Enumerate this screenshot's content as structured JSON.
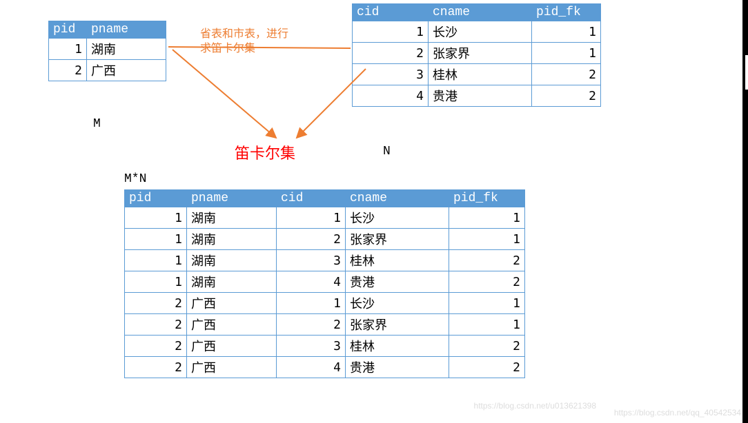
{
  "leftTable": {
    "headers": [
      "pid",
      "pname"
    ],
    "rows": [
      {
        "pid": 1,
        "pname": "湖南"
      },
      {
        "pid": 2,
        "pname": "广西"
      }
    ]
  },
  "rightTable": {
    "headers": [
      "cid",
      "cname",
      "pid_fk"
    ],
    "rows": [
      {
        "cid": 1,
        "cname": "长沙",
        "pid_fk": 1
      },
      {
        "cid": 2,
        "cname": "张家界",
        "pid_fk": 1
      },
      {
        "cid": 3,
        "cname": "桂林",
        "pid_fk": 2
      },
      {
        "cid": 4,
        "cname": "贵港",
        "pid_fk": 2
      }
    ]
  },
  "resultTable": {
    "headers": [
      "pid",
      "pname",
      "cid",
      "cname",
      "pid_fk"
    ],
    "rows": [
      {
        "pid": 1,
        "pname": "湖南",
        "cid": 1,
        "cname": "长沙",
        "pid_fk": 1
      },
      {
        "pid": 1,
        "pname": "湖南",
        "cid": 2,
        "cname": "张家界",
        "pid_fk": 1
      },
      {
        "pid": 1,
        "pname": "湖南",
        "cid": 3,
        "cname": "桂林",
        "pid_fk": 2
      },
      {
        "pid": 1,
        "pname": "湖南",
        "cid": 4,
        "cname": "贵港",
        "pid_fk": 2
      },
      {
        "pid": 2,
        "pname": "广西",
        "cid": 1,
        "cname": "长沙",
        "pid_fk": 1
      },
      {
        "pid": 2,
        "pname": "广西",
        "cid": 2,
        "cname": "张家界",
        "pid_fk": 1
      },
      {
        "pid": 2,
        "pname": "广西",
        "cid": 3,
        "cname": "桂林",
        "pid_fk": 2
      },
      {
        "pid": 2,
        "pname": "广西",
        "cid": 4,
        "cname": "贵港",
        "pid_fk": 2
      }
    ]
  },
  "labels": {
    "M": "M",
    "N": "N",
    "MN": "M*N",
    "centerRed": "笛卡尔集",
    "annotation": "省表和市表，进行\n求笛卡尔集"
  },
  "watermarks": {
    "w1": "https://blog.csdn.net/u013621398",
    "w2": "https://blog.csdn.net/qq_40542534"
  }
}
